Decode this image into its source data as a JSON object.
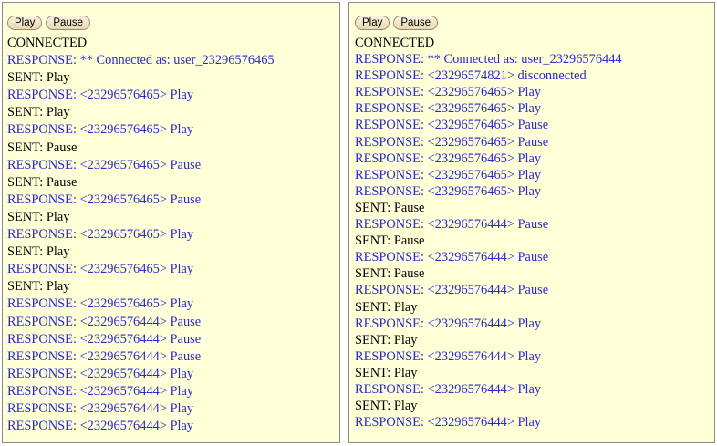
{
  "panels": [
    {
      "id": "left",
      "buttons": {
        "play_label": "Play",
        "pause_label": "Pause"
      },
      "log": [
        {
          "kind": "sys",
          "text": "CONNECTED"
        },
        {
          "kind": "resp",
          "text": "RESPONSE: ** Connected as: user_23296576465"
        },
        {
          "kind": "sent",
          "text": "SENT: Play"
        },
        {
          "kind": "resp",
          "text": "RESPONSE: <23296576465> Play"
        },
        {
          "kind": "sent",
          "text": "SENT: Play"
        },
        {
          "kind": "resp",
          "text": "RESPONSE: <23296576465> Play"
        },
        {
          "kind": "sent",
          "text": "SENT: Pause"
        },
        {
          "kind": "resp",
          "text": "RESPONSE: <23296576465> Pause"
        },
        {
          "kind": "sent",
          "text": "SENT: Pause"
        },
        {
          "kind": "resp",
          "text": "RESPONSE: <23296576465> Pause"
        },
        {
          "kind": "sent",
          "text": "SENT: Play"
        },
        {
          "kind": "resp",
          "text": "RESPONSE: <23296576465> Play"
        },
        {
          "kind": "sent",
          "text": "SENT: Play"
        },
        {
          "kind": "resp",
          "text": "RESPONSE: <23296576465> Play"
        },
        {
          "kind": "sent",
          "text": "SENT: Play"
        },
        {
          "kind": "resp",
          "text": "RESPONSE: <23296576465> Play"
        },
        {
          "kind": "resp",
          "text": "RESPONSE: <23296576444> Pause"
        },
        {
          "kind": "resp",
          "text": "RESPONSE: <23296576444> Pause"
        },
        {
          "kind": "resp",
          "text": "RESPONSE: <23296576444> Pause"
        },
        {
          "kind": "resp",
          "text": "RESPONSE: <23296576444> Play"
        },
        {
          "kind": "resp",
          "text": "RESPONSE: <23296576444> Play"
        },
        {
          "kind": "resp",
          "text": "RESPONSE: <23296576444> Play"
        },
        {
          "kind": "resp",
          "text": "RESPONSE: <23296576444> Play"
        }
      ]
    },
    {
      "id": "right",
      "buttons": {
        "play_label": "Play",
        "pause_label": "Pause"
      },
      "log": [
        {
          "kind": "sys",
          "text": "CONNECTED"
        },
        {
          "kind": "resp",
          "text": "RESPONSE: ** Connected as: user_23296576444"
        },
        {
          "kind": "resp",
          "text": "RESPONSE: <23296574821> disconnected"
        },
        {
          "kind": "resp",
          "text": "RESPONSE: <23296576465> Play"
        },
        {
          "kind": "resp",
          "text": "RESPONSE: <23296576465> Play"
        },
        {
          "kind": "resp",
          "text": "RESPONSE: <23296576465> Pause"
        },
        {
          "kind": "resp",
          "text": "RESPONSE: <23296576465> Pause"
        },
        {
          "kind": "resp",
          "text": "RESPONSE: <23296576465> Play"
        },
        {
          "kind": "resp",
          "text": "RESPONSE: <23296576465> Play"
        },
        {
          "kind": "resp",
          "text": "RESPONSE: <23296576465> Play"
        },
        {
          "kind": "sent",
          "text": "SENT: Pause"
        },
        {
          "kind": "resp",
          "text": "RESPONSE: <23296576444> Pause"
        },
        {
          "kind": "sent",
          "text": "SENT: Pause"
        },
        {
          "kind": "resp",
          "text": "RESPONSE: <23296576444> Pause"
        },
        {
          "kind": "sent",
          "text": "SENT: Pause"
        },
        {
          "kind": "resp",
          "text": "RESPONSE: <23296576444> Pause"
        },
        {
          "kind": "sent",
          "text": "SENT: Play"
        },
        {
          "kind": "resp",
          "text": "RESPONSE: <23296576444> Play"
        },
        {
          "kind": "sent",
          "text": "SENT: Play"
        },
        {
          "kind": "resp",
          "text": "RESPONSE: <23296576444> Play"
        },
        {
          "kind": "sent",
          "text": "SENT: Play"
        },
        {
          "kind": "resp",
          "text": "RESPONSE: <23296576444> Play"
        },
        {
          "kind": "sent",
          "text": "SENT: Play"
        },
        {
          "kind": "resp",
          "text": "RESPONSE: <23296576444> Play"
        }
      ]
    }
  ],
  "colors": {
    "panel_bg": "#ffffd8",
    "response_text": "#2a2ad0",
    "plain_text": "#000000"
  }
}
